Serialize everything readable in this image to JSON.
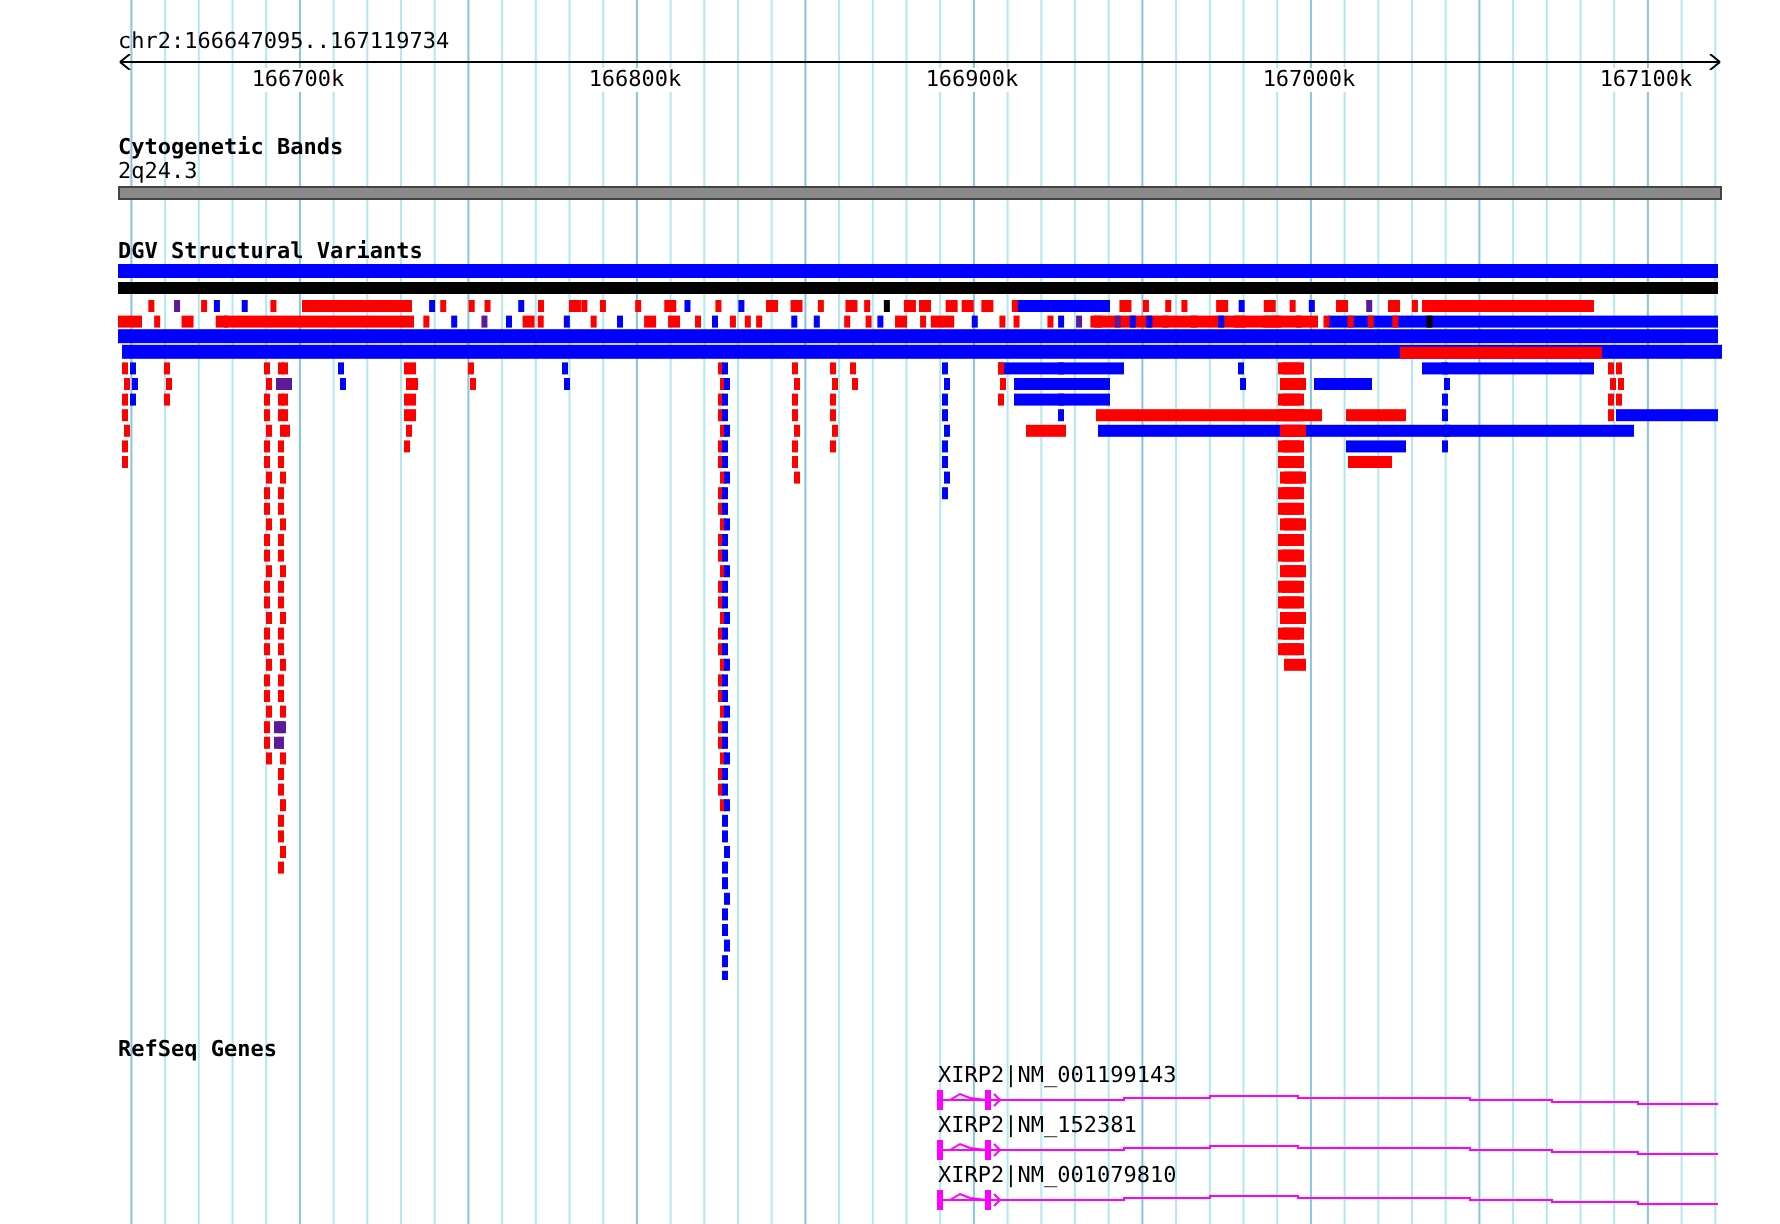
{
  "ruler": {
    "location": "chr2:166647095..167119734",
    "ticks": [
      "166700k",
      "166800k",
      "166900k",
      "167000k",
      "167100k"
    ]
  },
  "tracks": [
    {
      "kind": "bands",
      "title": "Cytogenetic Bands",
      "band": "2q24.3"
    },
    {
      "kind": "variants",
      "title": "DGV Structural Variants"
    },
    {
      "kind": "genes",
      "title": "RefSeq Genes",
      "genes": [
        {
          "label": "XIRP2|NM_001199143"
        },
        {
          "label": "XIRP2|NM_152381"
        },
        {
          "label": "XIRP2|NM_001079810"
        }
      ]
    }
  ]
}
